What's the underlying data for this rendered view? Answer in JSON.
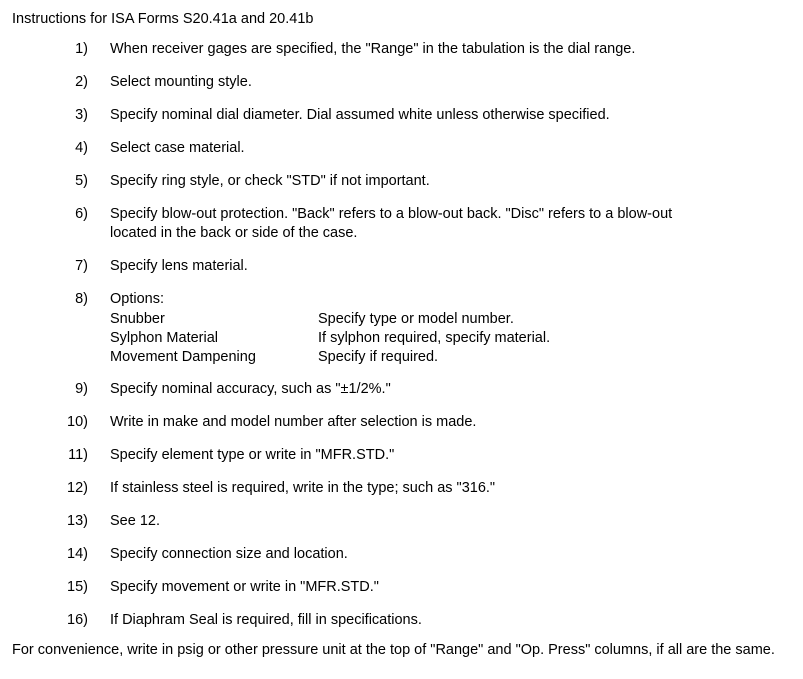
{
  "document": {
    "title": "Instructions for ISA Forms S20.41a and 20.41b",
    "items": [
      {
        "number": "1)",
        "text": "When receiver gages are specified, the \"Range\" in the tabulation is the dial range."
      },
      {
        "number": "2)",
        "text": "Select mounting style."
      },
      {
        "number": "3)",
        "text": "Specify nominal dial diameter.  Dial assumed white unless otherwise specified."
      },
      {
        "number": "4)",
        "text": "Select case material."
      },
      {
        "number": "5)",
        "text": "Specify ring style, or check \"STD\" if not important."
      },
      {
        "number": "6)",
        "text": "Specify blow-out protection.  \"Back\" refers to a blow-out back. \"Disc\" refers to a blow-out",
        "text_line2": "located in the back or side of the case."
      },
      {
        "number": "7)",
        "text": "Specify lens material."
      },
      {
        "number": "8)",
        "text": "Options:",
        "options": [
          {
            "label": "Snubber",
            "description": "Specify type or model number."
          },
          {
            "label": "Sylphon Material",
            "description": "If sylphon required, specify material."
          },
          {
            "label": "Movement Dampening",
            "description": "Specify if required."
          }
        ]
      },
      {
        "number": "9)",
        "text": "Specify nominal accuracy, such as \"±1/2%.\""
      },
      {
        "number": "10)",
        "text": "Write in make and model number after selection is made."
      },
      {
        "number": "11)",
        "text": "Specify element type or write in \"MFR.STD.\""
      },
      {
        "number": "12)",
        "text": "If stainless steel is required, write in the type; such as \"316.\""
      },
      {
        "number": "13)",
        "text": "See 12."
      },
      {
        "number": "14)",
        "text": "Specify connection size and location."
      },
      {
        "number": "15)",
        "text": "Specify movement or write in \"MFR.STD.\""
      },
      {
        "number": "16)",
        "text": "If Diaphram Seal is required, fill in specifications."
      }
    ],
    "closing": "For convenience, write in psig or other pressure unit at the top of \"Range\" and \"Op. Press\" columns, if all are the same."
  }
}
